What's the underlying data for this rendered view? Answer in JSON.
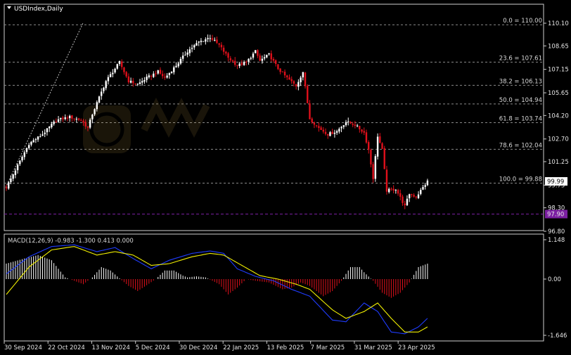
{
  "chart_title": "USDIndex,Daily",
  "colors": {
    "background": "#000000",
    "bull": "#ffffff",
    "bear": "#e0101b",
    "macd_line": "#1f3cff",
    "signal_line": "#f2f000",
    "hist_pos": "#ffffff",
    "hist_neg": "#e0101b",
    "level_purple": "#7b1fa2"
  },
  "watermark_icon": "wikifx-logo",
  "chart_data": {
    "type": "candlestick",
    "price_ylim": [
      96.8,
      110.1
    ],
    "price_ticks": [
      "110.10",
      "108.65",
      "107.15",
      "105.65",
      "104.20",
      "102.70",
      "101.25",
      "99.75",
      "98.30",
      "96.80"
    ],
    "current_price": "99.99",
    "purple_level": "97.90",
    "x_ticks": [
      "30 Sep 2024",
      "22 Oct 2024",
      "13 Nov 2024",
      "5 Dec 2024",
      "30 Dec 2024",
      "22 Jan 2025",
      "13 Feb 2025",
      "7 Mar 2025",
      "31 Mar 2025",
      "23 Apr 2025"
    ],
    "fib_levels": [
      {
        "label": "0.0 = 110.00",
        "value": 110.0
      },
      {
        "label": "23.6 = 107.61",
        "value": 107.61
      },
      {
        "label": "38.2 = 106.13",
        "value": 106.13
      },
      {
        "label": "50.0 = 104.94",
        "value": 104.94
      },
      {
        "label": "61.8 = 103.74",
        "value": 103.74
      },
      {
        "label": "78.6 = 102.04",
        "value": 102.04
      },
      {
        "label": "100.0 = 99.88",
        "value": 99.88
      }
    ],
    "close_path": [
      [
        0,
        99.6
      ],
      [
        5,
        101.0
      ],
      [
        10,
        102.4
      ],
      [
        16,
        103.0
      ],
      [
        22,
        103.9
      ],
      [
        28,
        104.1
      ],
      [
        33,
        103.9
      ],
      [
        36,
        103.4
      ],
      [
        38,
        104.3
      ],
      [
        44,
        106.4
      ],
      [
        48,
        107.2
      ],
      [
        50,
        107.6
      ],
      [
        54,
        106.4
      ],
      [
        58,
        106.2
      ],
      [
        62,
        106.6
      ],
      [
        67,
        107.0
      ],
      [
        70,
        106.6
      ],
      [
        75,
        107.4
      ],
      [
        80,
        108.3
      ],
      [
        85,
        108.9
      ],
      [
        90,
        109.2
      ],
      [
        94,
        108.7
      ],
      [
        98,
        107.9
      ],
      [
        102,
        107.4
      ],
      [
        106,
        107.6
      ],
      [
        110,
        108.3
      ],
      [
        112,
        107.7
      ],
      [
        116,
        108.1
      ],
      [
        120,
        107.2
      ],
      [
        124,
        106.6
      ],
      [
        128,
        106.1
      ],
      [
        131,
        107.0
      ],
      [
        134,
        104.0
      ],
      [
        138,
        103.4
      ],
      [
        142,
        103.0
      ],
      [
        146,
        103.2
      ],
      [
        150,
        103.8
      ],
      [
        154,
        103.6
      ],
      [
        158,
        103.1
      ],
      [
        160,
        102.0
      ],
      [
        162,
        100.2
      ],
      [
        164,
        102.9
      ],
      [
        166,
        102.0
      ],
      [
        168,
        99.4
      ],
      [
        172,
        99.5
      ],
      [
        176,
        98.4
      ],
      [
        178,
        99.2
      ],
      [
        181,
        99.0
      ],
      [
        184,
        99.6
      ],
      [
        186,
        99.99
      ]
    ],
    "macd": {
      "label": "MACD(12,26,9) -0.983 -1.300 0.413 0.000",
      "ylim": [
        -1.646,
        1.148
      ],
      "ticks": [
        "1.148",
        "0.00",
        "-1.646"
      ],
      "macd_path": [
        [
          0,
          0.15
        ],
        [
          10,
          0.65
        ],
        [
          20,
          0.95
        ],
        [
          30,
          1.0
        ],
        [
          40,
          0.8
        ],
        [
          48,
          0.92
        ],
        [
          56,
          0.6
        ],
        [
          64,
          0.3
        ],
        [
          72,
          0.55
        ],
        [
          82,
          0.75
        ],
        [
          90,
          0.82
        ],
        [
          96,
          0.75
        ],
        [
          102,
          0.3
        ],
        [
          110,
          0.08
        ],
        [
          118,
          -0.05
        ],
        [
          126,
          -0.3
        ],
        [
          134,
          -0.5
        ],
        [
          144,
          -1.2
        ],
        [
          150,
          -1.25
        ],
        [
          158,
          -0.7
        ],
        [
          164,
          -0.95
        ],
        [
          170,
          -1.55
        ],
        [
          176,
          -1.6
        ],
        [
          182,
          -1.4
        ],
        [
          186,
          -1.15
        ]
      ],
      "signal_path": [
        [
          0,
          -0.45
        ],
        [
          10,
          0.35
        ],
        [
          20,
          0.85
        ],
        [
          30,
          0.95
        ],
        [
          40,
          0.7
        ],
        [
          48,
          0.8
        ],
        [
          56,
          0.7
        ],
        [
          64,
          0.4
        ],
        [
          72,
          0.45
        ],
        [
          82,
          0.65
        ],
        [
          90,
          0.75
        ],
        [
          96,
          0.7
        ],
        [
          104,
          0.4
        ],
        [
          112,
          0.1
        ],
        [
          120,
          0.0
        ],
        [
          128,
          -0.15
        ],
        [
          134,
          -0.3
        ],
        [
          144,
          -0.9
        ],
        [
          150,
          -1.15
        ],
        [
          158,
          -0.95
        ],
        [
          164,
          -0.7
        ],
        [
          170,
          -1.15
        ],
        [
          176,
          -1.55
        ],
        [
          182,
          -1.55
        ],
        [
          186,
          -1.4
        ]
      ],
      "hist_path": [
        [
          0,
          0.45
        ],
        [
          8,
          0.6
        ],
        [
          14,
          0.7
        ],
        [
          20,
          0.55
        ],
        [
          26,
          0.05
        ],
        [
          30,
          -0.05
        ],
        [
          34,
          -0.15
        ],
        [
          38,
          0.05
        ],
        [
          42,
          0.35
        ],
        [
          46,
          0.25
        ],
        [
          50,
          0.02
        ],
        [
          54,
          -0.2
        ],
        [
          58,
          -0.35
        ],
        [
          62,
          -0.18
        ],
        [
          66,
          0.0
        ],
        [
          70,
          0.25
        ],
        [
          74,
          0.25
        ],
        [
          78,
          0.1
        ],
        [
          80,
          0.05
        ],
        [
          84,
          0.08
        ],
        [
          88,
          0.05
        ],
        [
          94,
          -0.15
        ],
        [
          98,
          -0.45
        ],
        [
          102,
          -0.25
        ],
        [
          106,
          0.0
        ],
        [
          110,
          -0.05
        ],
        [
          116,
          -0.1
        ],
        [
          122,
          -0.3
        ],
        [
          126,
          -0.25
        ],
        [
          130,
          -0.1
        ],
        [
          134,
          -0.2
        ],
        [
          140,
          -0.5
        ],
        [
          144,
          -0.35
        ],
        [
          148,
          -0.05
        ],
        [
          152,
          0.35
        ],
        [
          156,
          0.35
        ],
        [
          158,
          0.2
        ],
        [
          162,
          -0.05
        ],
        [
          166,
          -0.4
        ],
        [
          170,
          -0.55
        ],
        [
          174,
          -0.4
        ],
        [
          178,
          -0.1
        ],
        [
          182,
          0.35
        ],
        [
          186,
          0.45
        ]
      ]
    }
  }
}
